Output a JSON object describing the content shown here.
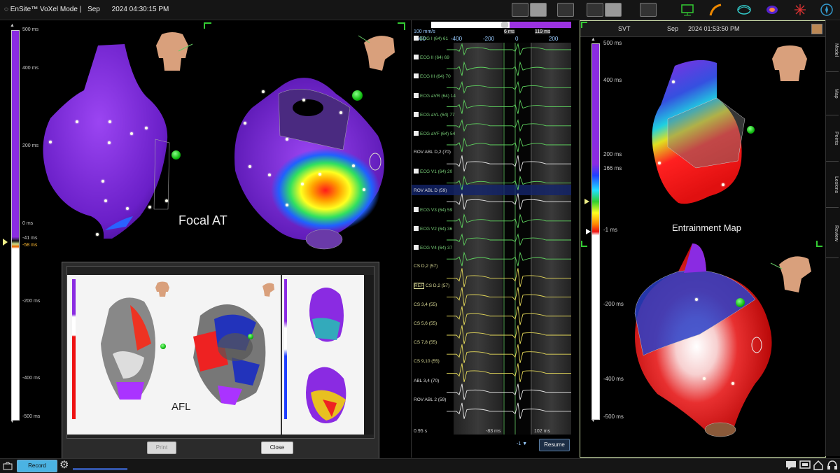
{
  "titlebar": {
    "app_title": "EnSite™ VoXel Mode |",
    "month": "Sep",
    "time": "2024 04:30:15 PM"
  },
  "left_map": {
    "scale_ticks": [
      "500 ms",
      "400 ms",
      "200 ms",
      "0 ms",
      "-41 ms",
      "-58 ms",
      "-200 ms",
      "-400 ms",
      "-500 ms"
    ],
    "label": "Focal AT"
  },
  "ecg": {
    "speed": "100 mm/s",
    "time_ticks": [
      "-600",
      "-400",
      "-200",
      "0",
      "200"
    ],
    "marker_left": "6 ms",
    "marker_right": "119 ms",
    "channels": [
      {
        "label": "ECG I (64)",
        "value": "61",
        "checked": true,
        "color": "green"
      },
      {
        "label": "ECG II (64)",
        "value": "69",
        "checked": true,
        "color": "green"
      },
      {
        "label": "ECG III (64)",
        "value": "70",
        "checked": true,
        "color": "green"
      },
      {
        "label": "ECG aVR (64)",
        "value": "14",
        "checked": true,
        "color": "green"
      },
      {
        "label": "ECG aVL (64)",
        "value": "77",
        "checked": true,
        "color": "green"
      },
      {
        "label": "ECG aVF (64)",
        "value": "54",
        "checked": true,
        "color": "green"
      },
      {
        "label": "ROV ABL D,2 (70)",
        "value": "",
        "checked": false,
        "color": "white"
      },
      {
        "label": "ECG V1 (64)",
        "value": "20",
        "checked": true,
        "color": "green"
      },
      {
        "label": "ROV ABL D (59)",
        "value": "",
        "checked": false,
        "color": "white"
      },
      {
        "label": "ECG V3 (64)",
        "value": "59",
        "checked": true,
        "color": "green"
      },
      {
        "label": "ECG V2 (64)",
        "value": "36",
        "checked": true,
        "color": "green"
      },
      {
        "label": "ECG V4 (64)",
        "value": "37",
        "checked": true,
        "color": "green"
      },
      {
        "label": "CS D,2 (57)",
        "value": "",
        "checked": false,
        "color": "yellow"
      },
      {
        "label": "CS D,2 (57)",
        "value": "",
        "checked": false,
        "color": "yellow",
        "ref": "REF"
      },
      {
        "label": "CS 3,4 (55)",
        "value": "",
        "checked": false,
        "color": "yellow"
      },
      {
        "label": "CS 5,6 (55)",
        "value": "",
        "checked": false,
        "color": "yellow"
      },
      {
        "label": "CS 7,8 (55)",
        "value": "",
        "checked": false,
        "color": "yellow"
      },
      {
        "label": "CS 9,10 (55)",
        "value": "",
        "checked": false,
        "color": "yellow"
      },
      {
        "label": "ABL 3,4 (70)",
        "value": "",
        "checked": false,
        "color": "white"
      },
      {
        "label": "ROV ABL 2 (59)",
        "value": "",
        "checked": false,
        "color": "white"
      }
    ],
    "sweep": "0.95 s",
    "interval_left": "-83 ms",
    "interval_right": "102 ms",
    "resume_label": "Resume",
    "dropdown_value": "-1"
  },
  "right_map": {
    "header_title": "SVT",
    "month": "Sep",
    "time": "2024 01:53:50 PM",
    "scale_ticks": [
      "500 ms",
      "400 ms",
      "200 ms",
      "166 ms",
      "-1 ms",
      "-200 ms",
      "-400 ms",
      "-500 ms"
    ],
    "label": "Entrainment Map",
    "tabs": [
      "Model",
      "Map",
      "Points",
      "Lesions",
      "Review"
    ]
  },
  "overlay": {
    "label": "AFL",
    "print_label": "Print",
    "close_label": "Close"
  },
  "bottombar": {
    "record_label": "Record"
  },
  "colors": {
    "accent_blue": "#4bb3e3",
    "map_purple": "#7a2ad6",
    "ecg_green": "#5fd35f",
    "cs_yellow": "#e5d95a"
  }
}
